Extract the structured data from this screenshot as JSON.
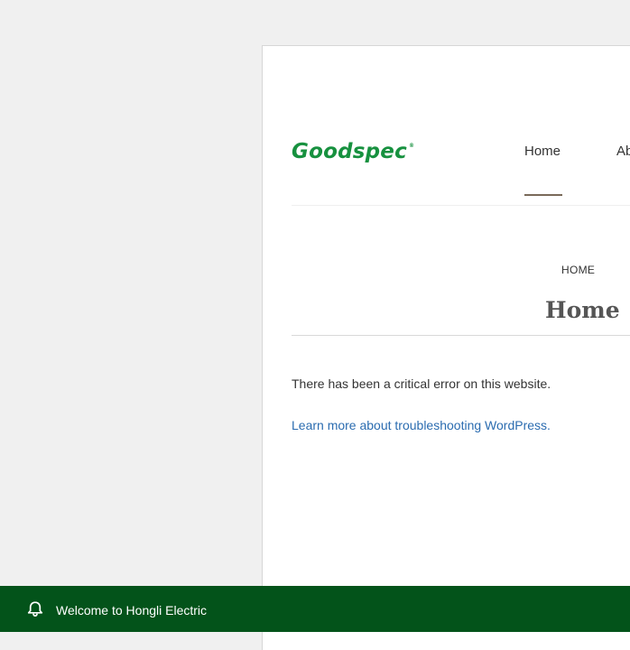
{
  "header": {
    "logo_text": "Goodspec",
    "logo_mark": "®",
    "brand_color": "#17913f"
  },
  "nav": {
    "items": [
      {
        "label": "Home",
        "active": true
      },
      {
        "label": "Ab"
      }
    ]
  },
  "breadcrumb": {
    "current": "HOME"
  },
  "page": {
    "title": "Home",
    "error_message": "There has been a critical error on this website.",
    "help_link": "Learn more about troubleshooting WordPress."
  },
  "notice": {
    "icon": "bell-icon",
    "text": "Welcome to Hongli Electric",
    "background": "#03531a"
  }
}
